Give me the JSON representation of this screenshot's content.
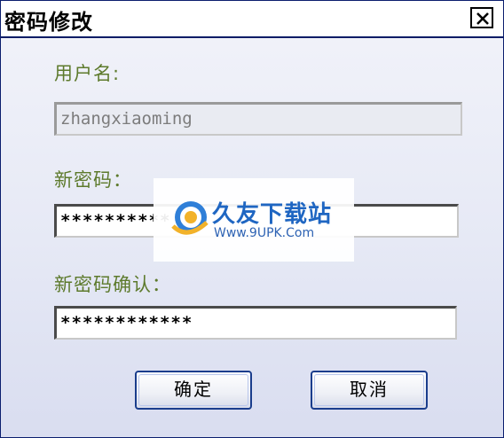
{
  "window": {
    "title": "密码修改",
    "close_icon": "close-icon"
  },
  "form": {
    "username_label": "用户名:",
    "username_value": "zhangxiaoming",
    "new_password_label": "新密码：",
    "new_password_value": "**********",
    "confirm_password_label": "新密码确认：",
    "confirm_password_value": "************"
  },
  "buttons": {
    "ok_label": "确定",
    "cancel_label": "取消"
  },
  "watermark": {
    "title": "久友下载站",
    "url": "Www.9UPK.Com",
    "icon": "globe-logo-icon"
  },
  "colors": {
    "label": "#5d7a2c",
    "title_border": "#0a1c66",
    "button_border": "#1a3d8c"
  }
}
